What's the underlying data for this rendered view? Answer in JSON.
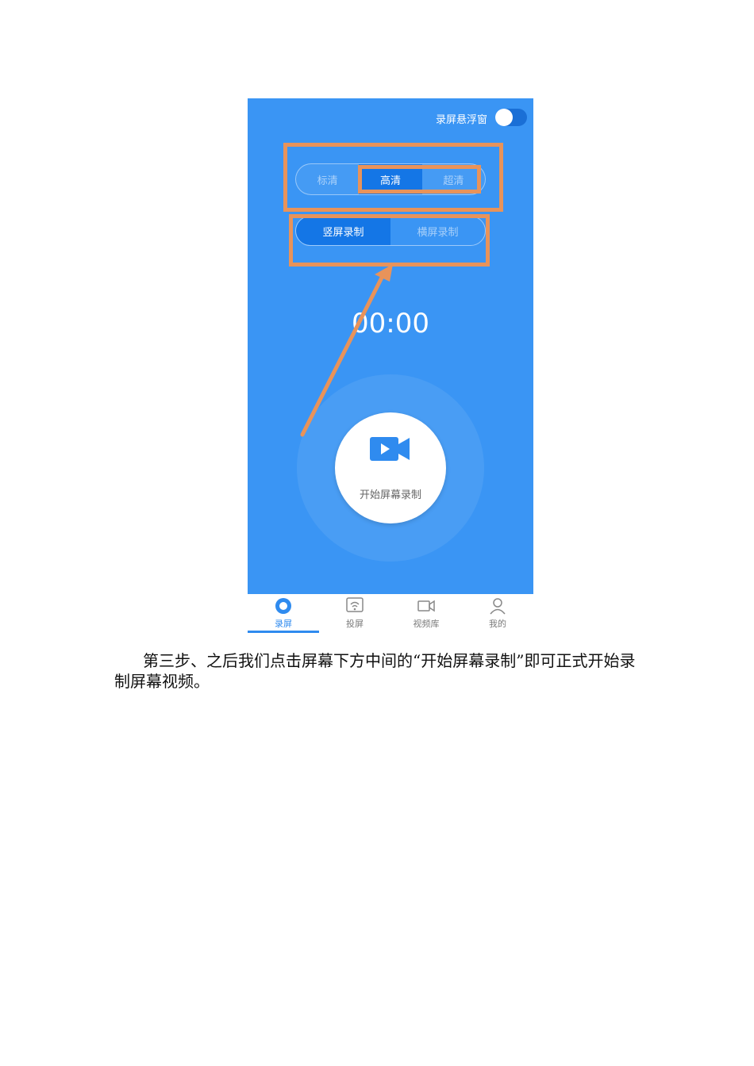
{
  "screen": {
    "float_window_label": "录屏悬浮窗",
    "quality_options": [
      "标清",
      "高清",
      "超清"
    ],
    "orientation_options": [
      "竖屏录制",
      "横屏录制"
    ],
    "timer": "00:00",
    "start_button_label": "开始屏幕录制"
  },
  "tabbar": {
    "items": [
      {
        "label": "录屏",
        "icon": "record-icon"
      },
      {
        "label": "投屏",
        "icon": "cast-icon"
      },
      {
        "label": "视频库",
        "icon": "video-camera-icon"
      },
      {
        "label": "我的",
        "icon": "profile-icon"
      }
    ]
  },
  "paragraph": "第三步、之后我们点击屏幕下方中间的“开始屏幕录制”即可正式开始录制屏幕视频。",
  "colors": {
    "app_blue": "#3a95f4",
    "selected_blue": "#1476e6",
    "annotation_orange": "#e8935a"
  }
}
